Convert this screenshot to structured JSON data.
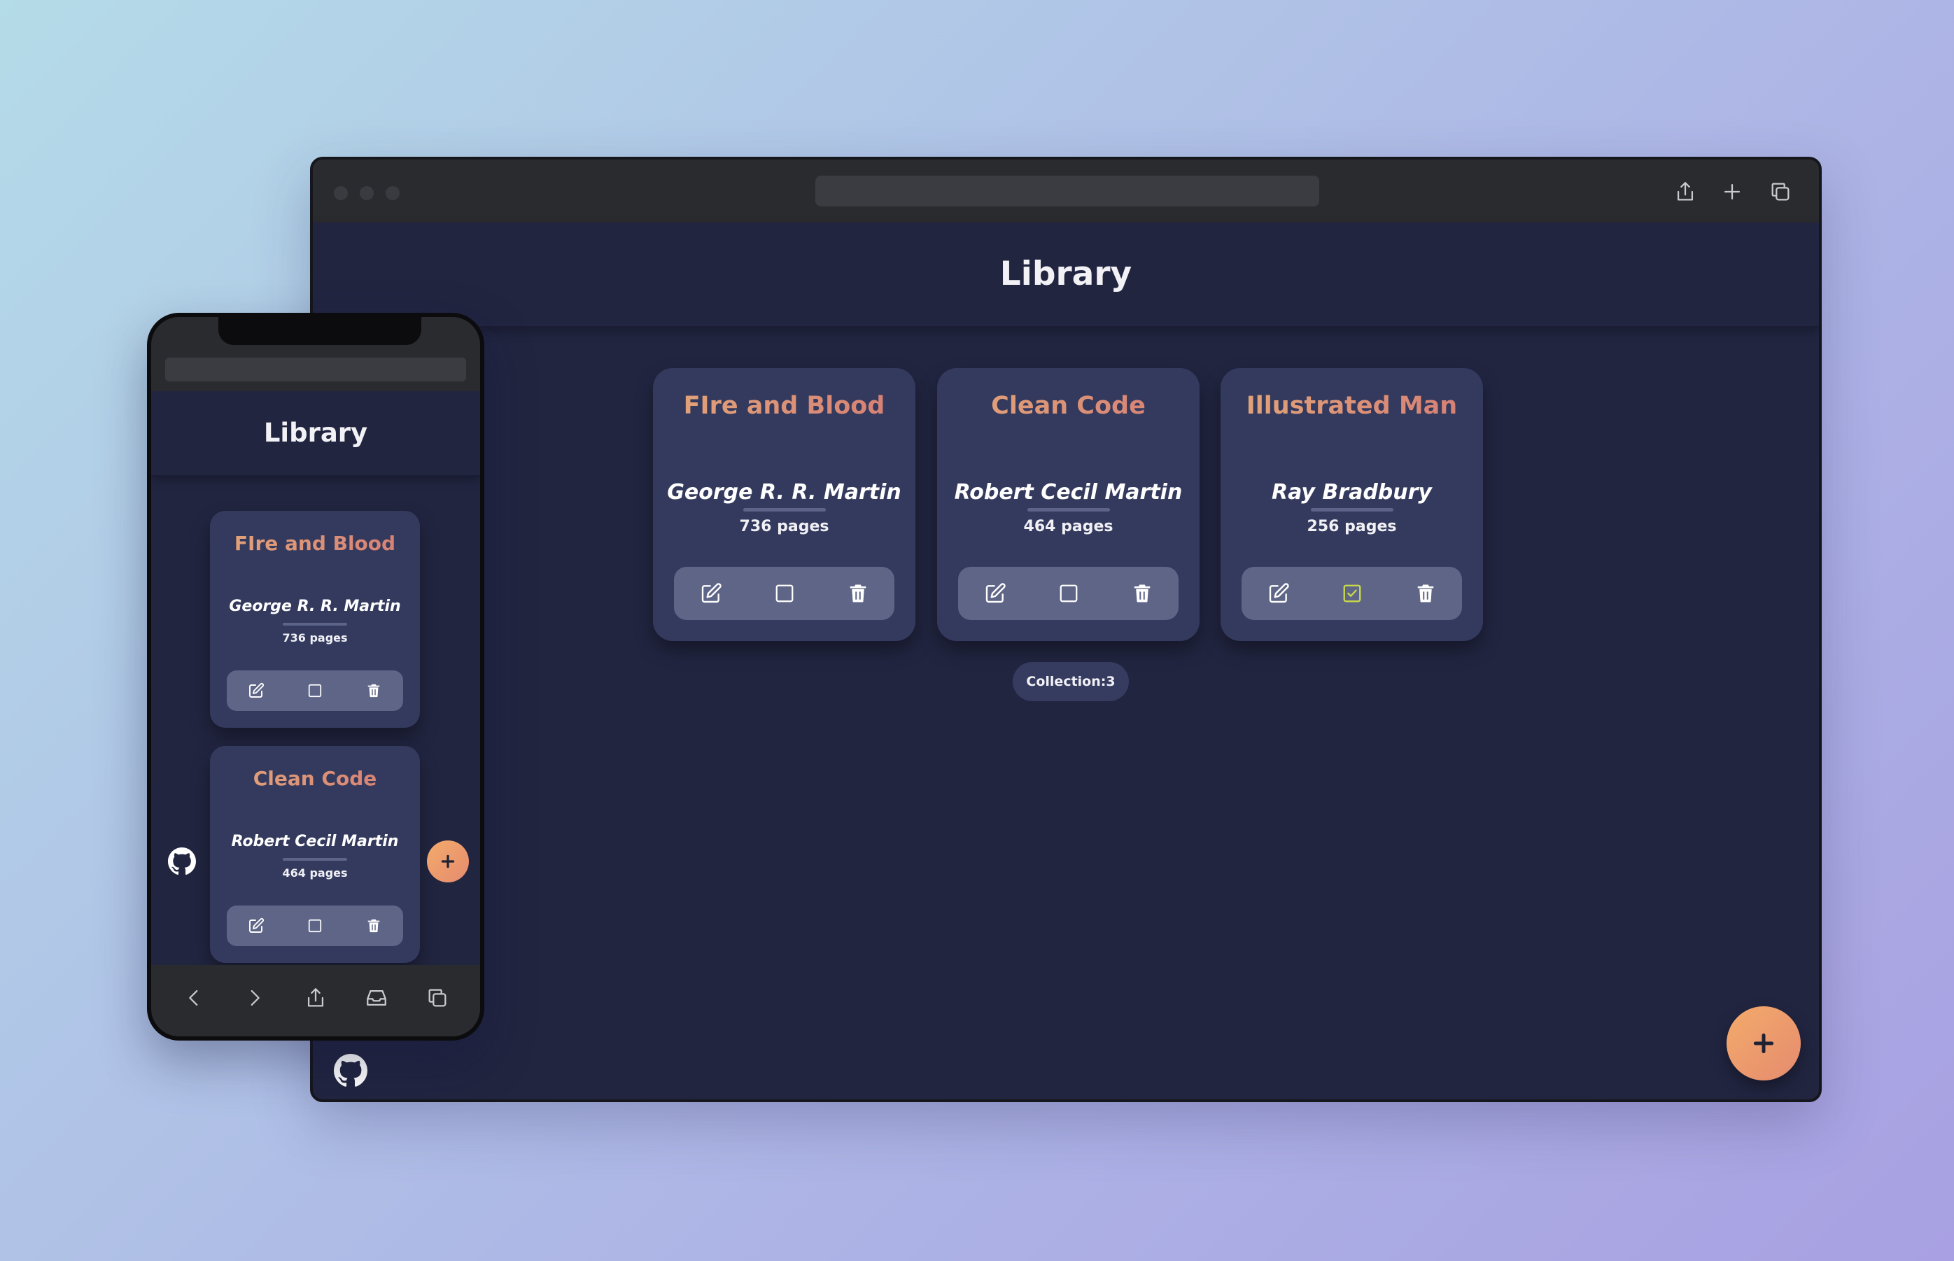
{
  "app": {
    "title": "Library"
  },
  "desktop": {
    "books": [
      {
        "title": "FIre and Blood",
        "author": "George R. R. Martin",
        "pages": "736 pages",
        "read": false
      },
      {
        "title": "Clean Code",
        "author": "Robert Cecil Martin",
        "pages": "464 pages",
        "read": false
      },
      {
        "title": "Illustrated Man",
        "author": "Ray Bradbury",
        "pages": "256 pages",
        "read": true
      }
    ],
    "collection_label": "Collection:3",
    "add_button": "+"
  },
  "mobile": {
    "books": [
      {
        "title": "FIre and Blood",
        "author": "George R. R. Martin",
        "pages": "736 pages",
        "read": false
      },
      {
        "title": "Clean Code",
        "author": "Robert Cecil Martin",
        "pages": "464 pages",
        "read": false
      }
    ],
    "add_button": "+"
  },
  "icons": {
    "edit": "edit-icon",
    "checkbox_empty": "checkbox-empty-icon",
    "checkbox_checked": "checkbox-checked-icon",
    "delete": "trash-icon",
    "github": "github-icon",
    "share": "share-icon",
    "new_tab": "plus-icon",
    "tabs": "tabs-icon",
    "back": "chevron-left-icon",
    "forward": "chevron-right-icon",
    "inbox": "inbox-icon"
  },
  "colors": {
    "page_bg": "#212540",
    "card_bg": "#343a5e",
    "action_bar": "#5e6587",
    "title_gradient_start": "#e3a679",
    "title_gradient_end": "#d57d74",
    "checked_accent": "#c8d84a",
    "fab": "#ee9a6c"
  }
}
